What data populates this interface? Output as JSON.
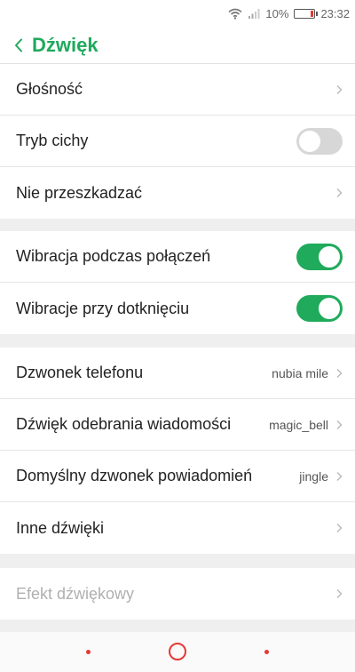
{
  "status": {
    "battery": "10%",
    "time": "23:32",
    "battery_level": 0.1
  },
  "header": {
    "title": "Dźwięk"
  },
  "sections": [
    [
      {
        "label": "Głośność",
        "type": "nav"
      },
      {
        "label": "Tryb cichy",
        "type": "toggle",
        "on": false
      },
      {
        "label": "Nie przeszkadzać",
        "type": "nav"
      }
    ],
    [
      {
        "label": "Wibracja podczas połączeń",
        "type": "toggle",
        "on": true
      },
      {
        "label": "Wibracje przy dotknięciu",
        "type": "toggle",
        "on": true
      }
    ],
    [
      {
        "label": "Dzwonek telefonu",
        "type": "nav",
        "value": "nubia mile"
      },
      {
        "label": "Dźwięk odebrania wiadomości",
        "type": "nav",
        "value": "magic_bell"
      },
      {
        "label": "Domyślny dzwonek powiadomień",
        "type": "nav",
        "value": "jingle"
      },
      {
        "label": "Inne dźwięki",
        "type": "nav"
      }
    ],
    [
      {
        "label": "Efekt dźwiękowy",
        "type": "nav",
        "disabled": true
      }
    ]
  ],
  "colors": {
    "accent": "#1faa5c",
    "nav_accent": "#e53935"
  }
}
